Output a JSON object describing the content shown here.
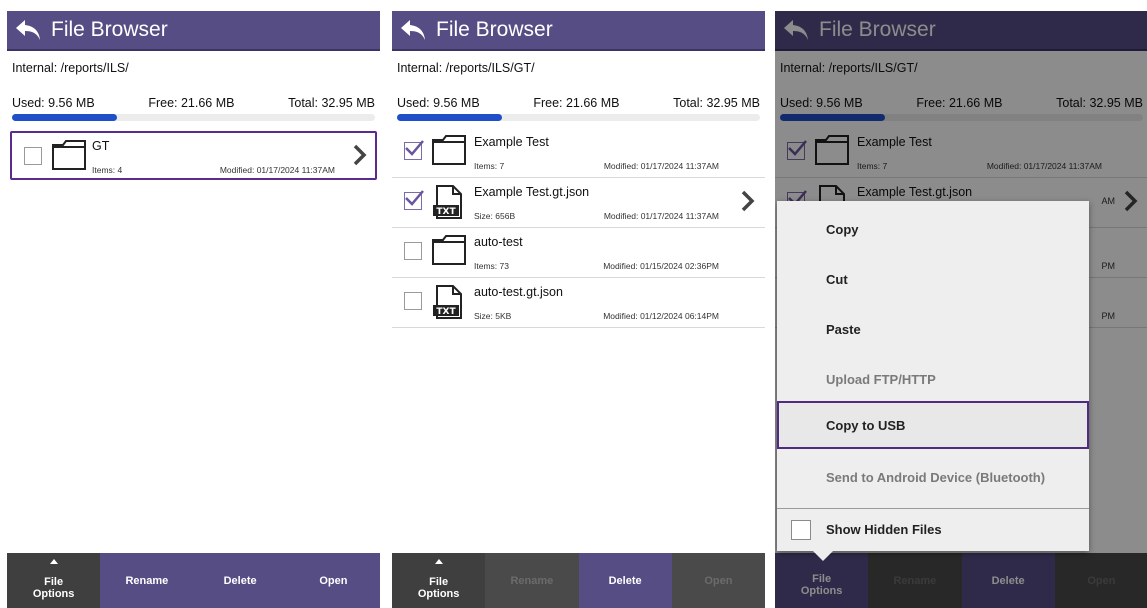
{
  "panels": [
    {
      "title": "File Browser",
      "path": "Internal: /reports/ILS/",
      "storage": {
        "used": "Used: 9.56 MB",
        "free": "Free: 21.66 MB",
        "total": "Total: 32.95 MB",
        "used_fraction": 0.29
      },
      "files": [
        {
          "name": "GT",
          "meta": "Items: 4",
          "modified": "Modified: 01/17/2024 11:37AM",
          "type": "folder",
          "checked": false,
          "selected": true,
          "chevron": true
        }
      ],
      "toolbar": {
        "file_options": "File\nOptions",
        "rename": "Rename",
        "delete": "Delete",
        "open": "Open"
      }
    },
    {
      "title": "File Browser",
      "path": "Internal: /reports/ILS/GT/",
      "storage": {
        "used": "Used: 9.56 MB",
        "free": "Free: 21.66 MB",
        "total": "Total: 32.95 MB",
        "used_fraction": 0.29
      },
      "files": [
        {
          "name": "Example Test",
          "meta": "Items: 7",
          "modified": "Modified: 01/17/2024 11:37AM",
          "type": "folder",
          "checked": true
        },
        {
          "name": "Example Test.gt.json",
          "meta": "Size: 656B",
          "modified": "Modified: 01/17/2024 11:37AM",
          "type": "txt",
          "checked": true,
          "chevron": true
        },
        {
          "name": "auto-test",
          "meta": "Items: 73",
          "modified": "Modified: 01/15/2024 02:36PM",
          "type": "folder",
          "checked": false
        },
        {
          "name": "auto-test.gt.json",
          "meta": "Size: 5KB",
          "modified": "Modified: 01/12/2024 06:14PM",
          "type": "txt",
          "checked": false
        }
      ],
      "toolbar": {
        "file_options": "File\nOptions",
        "rename": "Rename",
        "delete": "Delete",
        "open": "Open"
      }
    },
    {
      "title": "File Browser",
      "path": "Internal: /reports/ILS/GT/",
      "storage": {
        "used": "Used: 9.56 MB",
        "free": "Free: 21.66 MB",
        "total": "Total: 32.95 MB",
        "used_fraction": 0.29
      },
      "files": [
        {
          "name": "Example Test",
          "meta": "Items: 7",
          "modified": "Modified: 01/17/2024 11:37AM",
          "type": "folder",
          "checked": true
        },
        {
          "name": "Example Test.gt.json",
          "meta": "",
          "modified": "",
          "modified_tail": "AM",
          "type": "txt",
          "checked": true,
          "chevron": true
        },
        {
          "name": "",
          "meta": "",
          "modified": "",
          "modified_tail": "PM",
          "type": "none",
          "checked": false
        },
        {
          "name": "",
          "meta": "",
          "modified": "",
          "modified_tail": "PM",
          "type": "none",
          "checked": false
        }
      ],
      "context_menu": {
        "items": [
          {
            "label": "Copy",
            "enabled": true
          },
          {
            "label": "Cut",
            "enabled": true
          },
          {
            "label": "Paste",
            "enabled": true
          },
          {
            "label": "Upload FTP/HTTP",
            "enabled": false
          },
          {
            "label": "Copy to USB",
            "enabled": true,
            "highlighted": true
          },
          {
            "label": "Send to Android Device (Bluetooth)",
            "enabled": false
          }
        ],
        "show_hidden_files": "Show Hidden Files"
      },
      "toolbar": {
        "file_options": "File\nOptions",
        "rename": "Rename",
        "delete": "Delete",
        "open": "Open"
      }
    }
  ],
  "colors": {
    "title_bar": "#574d85",
    "selection_border": "#5a2a8c",
    "progress": "#1f4fc9"
  }
}
